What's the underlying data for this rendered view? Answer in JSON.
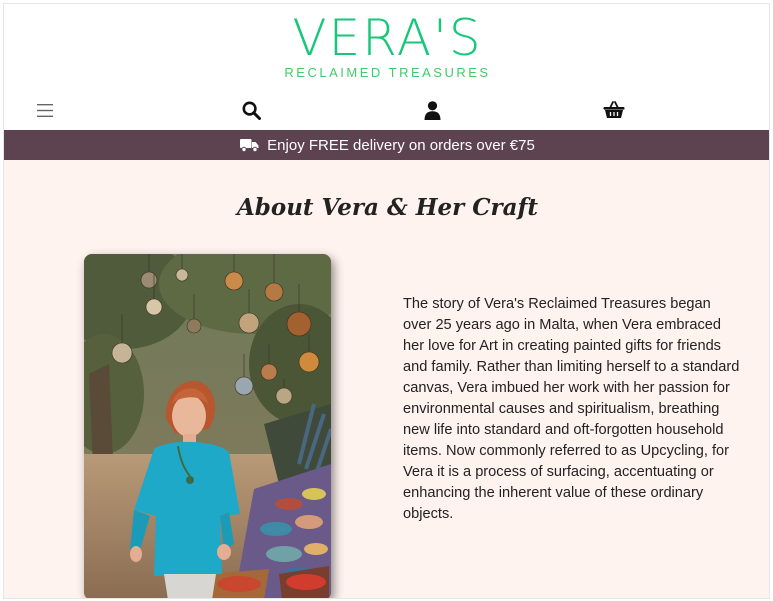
{
  "brand": {
    "name": "VERA'S",
    "tagline": "RECLAIMED TREASURES"
  },
  "nav": {
    "icons": [
      "menu-icon",
      "search-icon",
      "account-icon",
      "basket-icon"
    ]
  },
  "banner": {
    "text": "Enjoy FREE delivery on orders over €75",
    "icon": "truck-icon"
  },
  "about": {
    "title": "About Vera & Her Craft",
    "story": "The story of Vera's Reclaimed Treasures began over 25 years ago in Malta, when Vera embraced her love for Art in creating painted gifts for friends and family. Rather than limiting herself to a standard canvas, Vera imbued her work with her passion for environmental causes and spiritualism, breathing new life into standard and oft-forgotten household items. Now commonly referred to as Upcycling, for Vera it is a process of surfacing, accentuating or enhancing the inherent value of these ordinary objects."
  },
  "colors": {
    "brand_green": "#16c77a",
    "banner_bg": "#5d4350",
    "content_bg": "#fff3ef"
  }
}
